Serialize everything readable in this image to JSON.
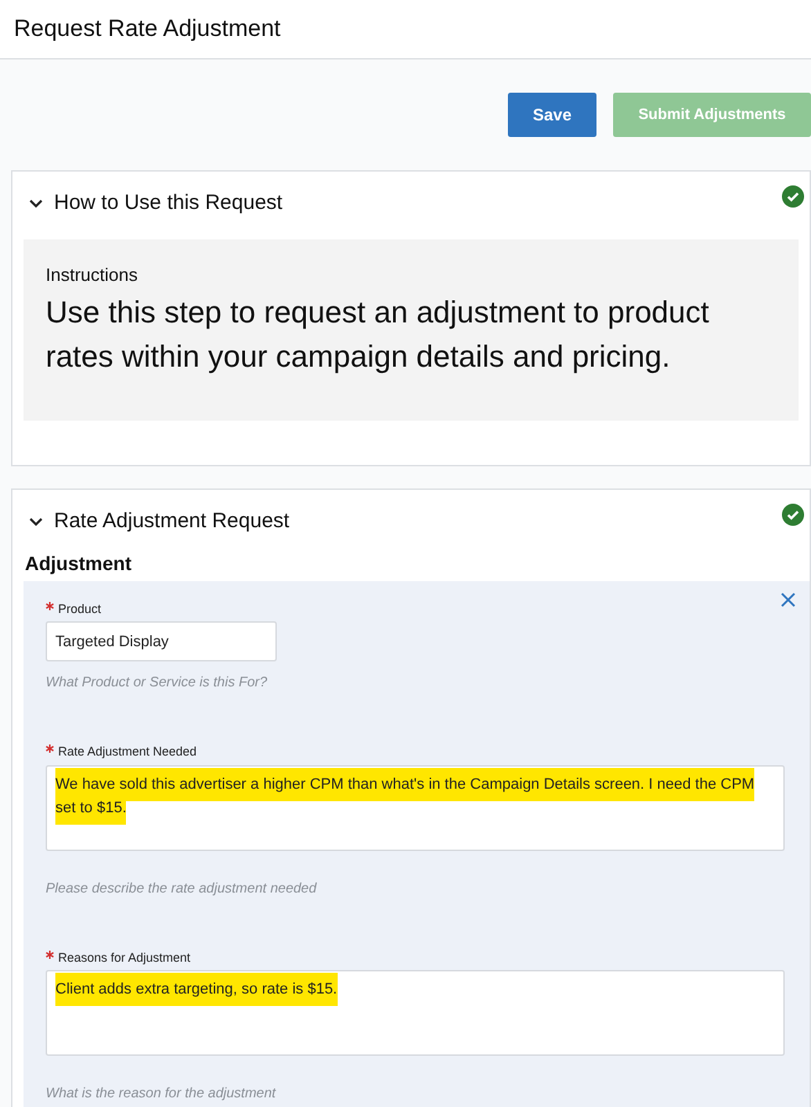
{
  "page": {
    "title": "Request Rate Adjustment"
  },
  "actions": [
    {
      "label": "Save",
      "disabled": false
    },
    {
      "label": "Submit Adjustments",
      "disabled": true
    }
  ],
  "sections": [
    {
      "title": "How to Use this Request",
      "expanded": true,
      "complete": true,
      "kind": "instructions",
      "label": "Instructions",
      "text": "Use this step to request an adjustment to product rates within your campaign details and pricing."
    },
    {
      "title": "Rate Adjustment Request",
      "expanded": true,
      "complete": true,
      "kind": "form",
      "label": "Adjustment",
      "fields": [
        {
          "kind": "input",
          "label": "Product",
          "required": true,
          "value": "Targeted Display",
          "hint": "What Product or Service is this For?",
          "highlighted": false
        },
        {
          "kind": "textarea",
          "label": "Rate Adjustment Needed",
          "required": true,
          "value": "We have sold this advertiser a higher CPM than what's in the Campaign Details screen. I need the CPM set to $15.",
          "hint": "Please describe the rate adjustment needed",
          "highlighted": true
        },
        {
          "kind": "textarea",
          "label": "Reasons for Adjustment",
          "required": true,
          "value": "Client adds extra targeting, so rate is $15.",
          "hint": "What is the reason for the adjustment",
          "highlighted": true
        }
      ]
    }
  ]
}
